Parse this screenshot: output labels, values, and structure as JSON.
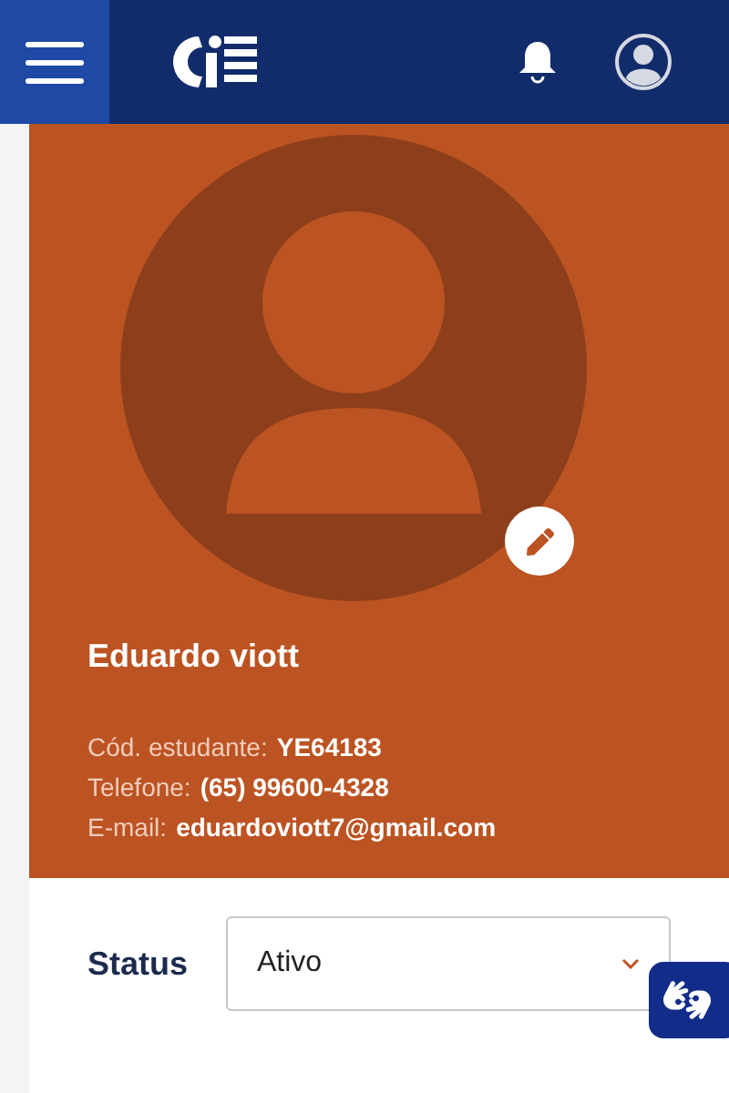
{
  "header": {
    "has_notifications": true
  },
  "profile": {
    "name": "Eduardo viott",
    "fields": [
      {
        "label": "Cód. estudante:",
        "value": "YE64183"
      },
      {
        "label": "Telefone:",
        "value": "(65) 99600-4328"
      },
      {
        "label": "E-mail:",
        "value": "eduardoviott7@gmail.com"
      }
    ]
  },
  "status": {
    "label": "Status",
    "value": "Ativo"
  }
}
